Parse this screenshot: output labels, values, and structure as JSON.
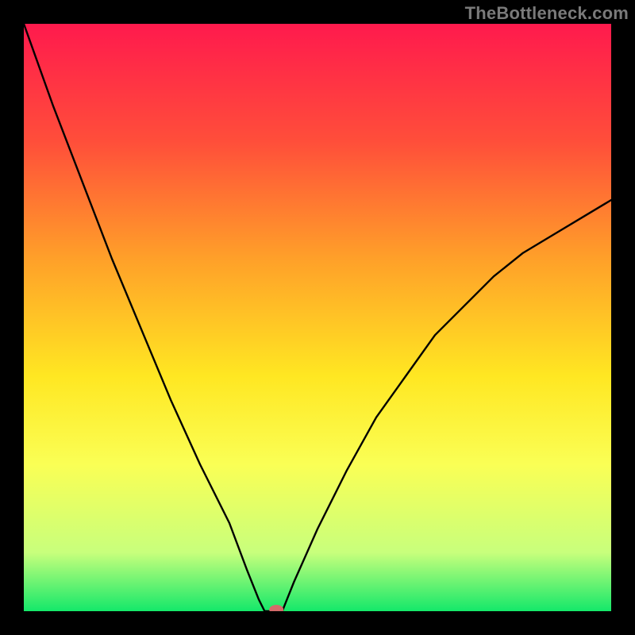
{
  "watermark": "TheBottleneck.com",
  "chart_data": {
    "type": "line",
    "title": "",
    "xlabel": "",
    "ylabel": "",
    "xlim": [
      0,
      100
    ],
    "ylim": [
      0,
      100
    ],
    "grid": false,
    "legend": false,
    "gradient_stops": [
      {
        "offset": 0,
        "color": "#ff1a4d"
      },
      {
        "offset": 20,
        "color": "#ff4e3a"
      },
      {
        "offset": 40,
        "color": "#ffa029"
      },
      {
        "offset": 60,
        "color": "#ffe722"
      },
      {
        "offset": 75,
        "color": "#faff55"
      },
      {
        "offset": 90,
        "color": "#c8ff7c"
      },
      {
        "offset": 100,
        "color": "#14e86a"
      }
    ],
    "curve": {
      "left": {
        "x": [
          0,
          5,
          10,
          15,
          20,
          25,
          30,
          35,
          38,
          40,
          41
        ],
        "y": [
          100,
          86,
          73,
          60,
          48,
          36,
          25,
          15,
          7,
          2,
          0
        ]
      },
      "right": {
        "x": [
          44,
          46,
          50,
          55,
          60,
          65,
          70,
          75,
          80,
          85,
          90,
          95,
          100
        ],
        "y": [
          0,
          5,
          14,
          24,
          33,
          40,
          47,
          52,
          57,
          61,
          64,
          67,
          70
        ]
      },
      "flat": {
        "x": [
          41,
          44
        ],
        "y": [
          0,
          0
        ]
      }
    },
    "marker": {
      "x": 43,
      "y": 0,
      "color": "#d46a6a",
      "rx": 9,
      "ry": 6
    }
  }
}
